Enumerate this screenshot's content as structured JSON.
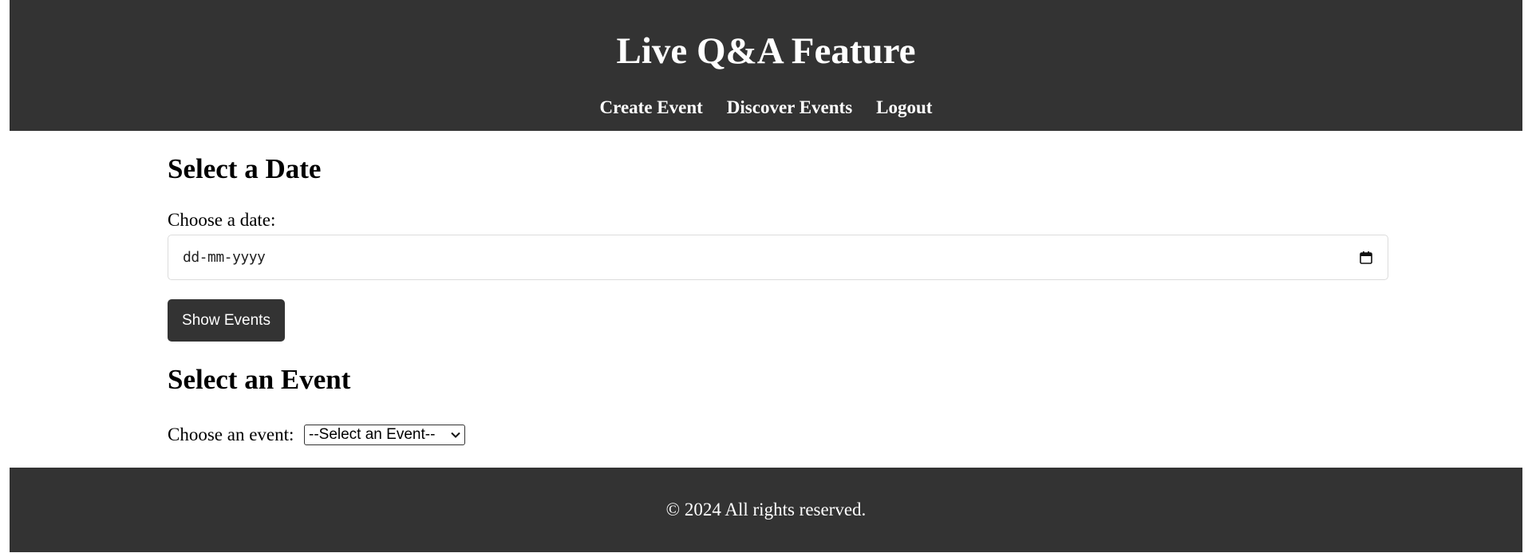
{
  "header": {
    "title": "Live Q&A Feature",
    "nav": [
      {
        "label": "Create Event"
      },
      {
        "label": "Discover Events"
      },
      {
        "label": "Logout"
      }
    ]
  },
  "date_section": {
    "heading": "Select a Date",
    "label": "Choose a date:",
    "date_value": "dd-mm-yyyy",
    "show_button": "Show Events"
  },
  "event_section": {
    "heading": "Select an Event",
    "label": "Choose an event:",
    "selected_option": "--Select an Event--"
  },
  "footer": {
    "copyright": "© 2024 All rights reserved."
  },
  "colors": {
    "header_bg": "#333333",
    "button_bg": "#333333",
    "text_light": "#ffffff"
  }
}
